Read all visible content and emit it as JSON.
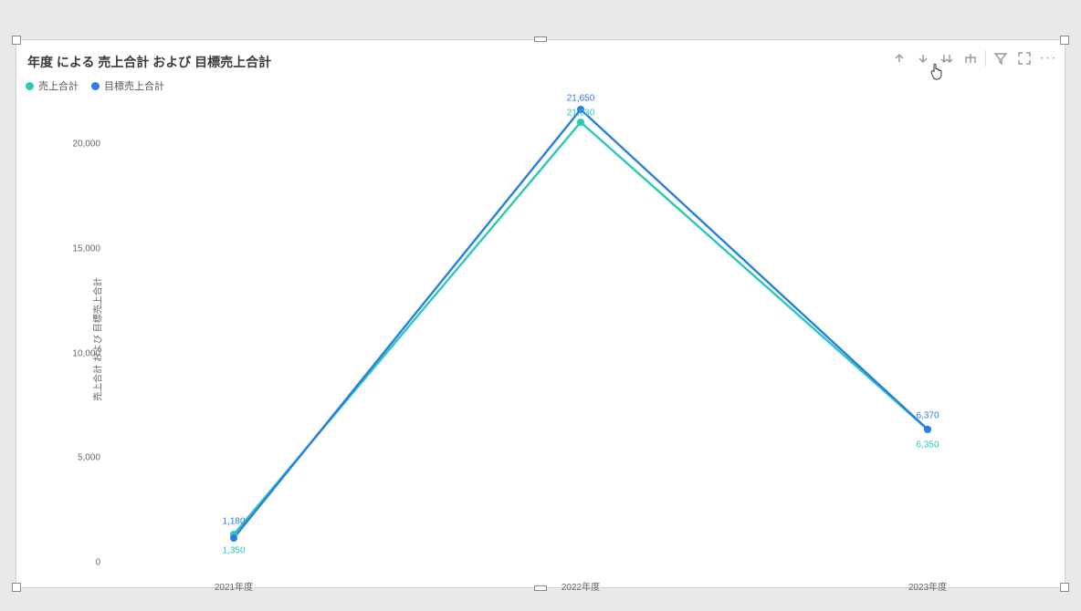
{
  "title": "年度 による 売上合計 および 目標売上合計",
  "ylabel": "売上合計 および 目標売上合計",
  "legend": {
    "series1": "売上合計",
    "series2": "目標売上合計"
  },
  "colors": {
    "series1": "#2ac8b8",
    "series2": "#2a7de1"
  },
  "yticks": [
    "0",
    "5,000",
    "10,000",
    "15,000",
    "20,000"
  ],
  "xticks": [
    "2021年度",
    "2022年度",
    "2023年度"
  ],
  "labels": {
    "s1_0": "1,350",
    "s1_1": "21,030",
    "s1_2": "6,350",
    "s2_0": "1,180",
    "s2_1": "21,650",
    "s2_2": "6,370"
  },
  "chart_data": {
    "type": "line",
    "title": "年度 による 売上合計 および 目標売上合計",
    "xlabel": "",
    "ylabel": "売上合計 および 目標売上合計",
    "categories": [
      "2021年度",
      "2022年度",
      "2023年度"
    ],
    "series": [
      {
        "name": "売上合計",
        "values": [
          1350,
          21030,
          6350
        ],
        "color": "#2ac8b8"
      },
      {
        "name": "目標売上合計",
        "values": [
          1180,
          21650,
          6370
        ],
        "color": "#2a7de1"
      }
    ],
    "ylim": [
      0,
      22000
    ],
    "yticks": [
      0,
      5000,
      10000,
      15000,
      20000
    ]
  }
}
